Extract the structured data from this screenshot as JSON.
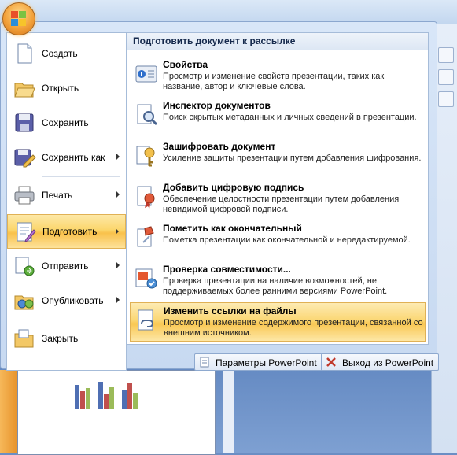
{
  "left_menu": [
    {
      "label": "Создать",
      "icon": "new-document-icon"
    },
    {
      "label": "Открыть",
      "icon": "open-folder-icon"
    },
    {
      "label": "Сохранить",
      "icon": "save-disk-icon"
    },
    {
      "label": "Сохранить как",
      "icon": "save-as-icon"
    },
    {
      "label": "Печать",
      "icon": "printer-icon"
    },
    {
      "label": "Подготовить",
      "icon": "prepare-document-icon"
    },
    {
      "label": "Отправить",
      "icon": "send-icon"
    },
    {
      "label": "Опубликовать",
      "icon": "publish-icon"
    },
    {
      "label": "Закрыть",
      "icon": "close-folder-icon"
    }
  ],
  "prepare_panel": {
    "header": "Подготовить документ к рассылке",
    "items": [
      {
        "title": "Свойства",
        "desc": "Просмотр и изменение свойств презентации, таких как название, автор и ключевые слова.",
        "icon": "properties-icon"
      },
      {
        "title": "Инспектор документов",
        "desc": "Поиск скрытых метаданных и личных сведений в презентации.",
        "icon": "inspect-document-icon"
      },
      {
        "title": "Зашифровать документ",
        "desc": "Усиление защиты презентации путем добавления шифрования.",
        "icon": "encrypt-key-icon"
      },
      {
        "title": "Добавить цифровую подпись",
        "desc": "Обеспечение целостности презентации путем добавления невидимой цифровой подписи.",
        "icon": "digital-signature-icon"
      },
      {
        "title": "Пометить как окончательный",
        "desc": "Пометка презентации как окончательной и нередактируемой.",
        "icon": "mark-final-icon"
      },
      {
        "title": "Проверка совместимости...",
        "desc": "Проверка презентации на наличие возможностей, не поддерживаемых более ранними версиями PowerPoint.",
        "icon": "compatibility-check-icon"
      },
      {
        "title": "Изменить ссылки на файлы",
        "desc": "Просмотр и изменение содержимого презентации, связанной со внешним источником.",
        "icon": "edit-links-icon"
      }
    ]
  },
  "footer": {
    "options_label": "Параметры PowerPoint",
    "exit_label": "Выход из PowerPoint"
  },
  "colors": {
    "highlight": "#fbd66b",
    "menu_bg": "#d8e6f8",
    "office_button": "#f2a13a"
  }
}
